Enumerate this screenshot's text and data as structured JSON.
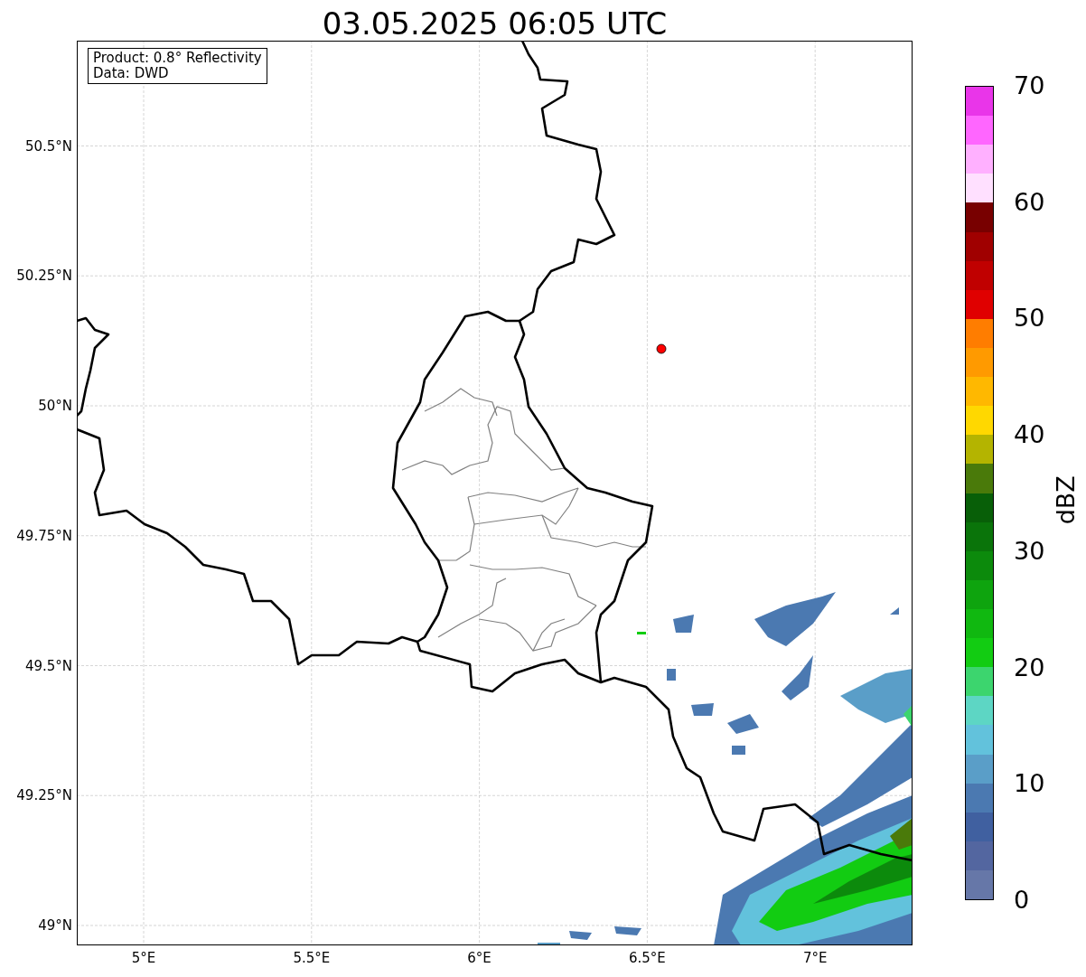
{
  "title": "03.05.2025 06:05 UTC",
  "info_box": [
    "Product: 0.8° Reflectivity",
    "Data: DWD"
  ],
  "y_ticks": [
    "50.5°N",
    "50.25°N",
    "50°N",
    "49.75°N",
    "49.5°N",
    "49.25°N",
    "49°N"
  ],
  "x_ticks": [
    "5°E",
    "5.5°E",
    "6°E",
    "6.5°E",
    "7°E"
  ],
  "colorbar": {
    "label": "dBZ",
    "ticks": [
      "70",
      "60",
      "50",
      "40",
      "30",
      "20",
      "10",
      "0"
    ],
    "bands": [
      {
        "color": "#e935e9"
      },
      {
        "color": "#ff66ff"
      },
      {
        "color": "#ffb0ff"
      },
      {
        "color": "#ffe0ff"
      },
      {
        "color": "#780000"
      },
      {
        "color": "#a00000"
      },
      {
        "color": "#c00000"
      },
      {
        "color": "#e00000"
      },
      {
        "color": "#ff7d00"
      },
      {
        "color": "#ff9a00"
      },
      {
        "color": "#ffb800"
      },
      {
        "color": "#ffd800"
      },
      {
        "color": "#b4b400"
      },
      {
        "color": "#4a7a0a"
      },
      {
        "color": "#085f08"
      },
      {
        "color": "#0a740a"
      },
      {
        "color": "#0c8a0c"
      },
      {
        "color": "#0ea40e"
      },
      {
        "color": "#10b810"
      },
      {
        "color": "#12cc12"
      },
      {
        "color": "#3cd56e"
      },
      {
        "color": "#5dd6c4"
      },
      {
        "color": "#62c2dc"
      },
      {
        "color": "#5a9ec8"
      },
      {
        "color": "#4b79b1"
      },
      {
        "color": "#4060a0"
      },
      {
        "color": "#5366a0"
      },
      {
        "color": "#6677a8"
      }
    ]
  }
}
